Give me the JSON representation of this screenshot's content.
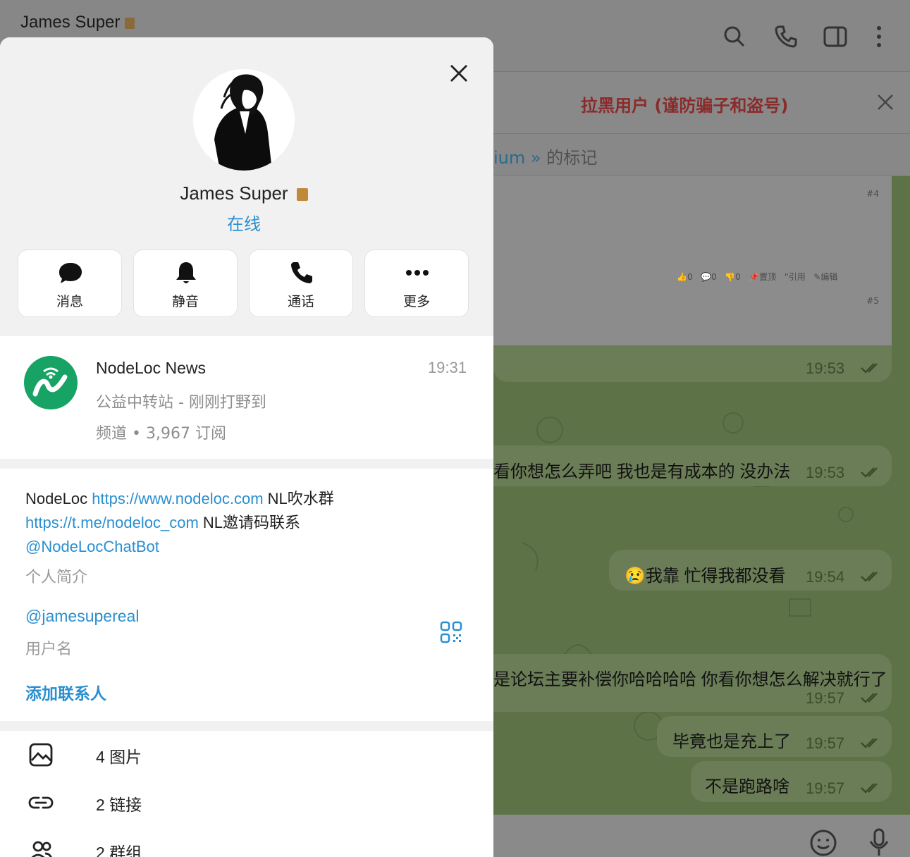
{
  "chat": {
    "title": "James Super",
    "pinned": "拉黑用户 (谨防骗子和盗号)",
    "tag_link": "ium »",
    "tag_suffix": " 的标记",
    "forum_post_numbers": [
      "#4",
      "#5"
    ],
    "forum_actions": "0  0  0  置顶  引用  编辑",
    "forum_action_items": [
      {
        "icon": "thumbs-up-icon",
        "label": "0"
      },
      {
        "icon": "comment-icon",
        "label": "0"
      },
      {
        "icon": "thumbs-down-icon",
        "label": "0"
      },
      {
        "icon": "pin-icon",
        "label": "置顶"
      },
      {
        "icon": "quote-icon",
        "label": "引用"
      },
      {
        "icon": "edit-icon",
        "label": "编辑"
      }
    ],
    "messages": [
      {
        "text": "",
        "time": "19:53"
      },
      {
        "text": "看你想怎么弄吧 我也是有成本的 没办法",
        "time": "19:53"
      },
      {
        "text": "😢我靠 忙得我都没看",
        "time": "19:54"
      },
      {
        "text": "是论坛主要补偿你哈哈哈哈 你看你想怎么解决就行了",
        "time": "19:57"
      },
      {
        "text": "毕竟也是充上了",
        "time": "19:57"
      },
      {
        "text": "不是跑路啥",
        "time": "19:57"
      }
    ],
    "header_icons": [
      "search-icon",
      "phone-icon",
      "sidebar-toggle-icon",
      "more-vertical-icon"
    ],
    "composer_icons": [
      "emoji-icon",
      "microphone-icon"
    ]
  },
  "profile": {
    "name": "James Super",
    "status": "在线",
    "actions": [
      {
        "label": "消息",
        "icon": "message-bubble-icon"
      },
      {
        "label": "静音",
        "icon": "bell-icon"
      },
      {
        "label": "通话",
        "icon": "phone-icon"
      },
      {
        "label": "更多",
        "icon": "more-horizontal-icon"
      }
    ],
    "channel": {
      "name": "NodeLoc News",
      "time": "19:31",
      "subtitle": "公益中转站 - 刚刚打野到",
      "meta": "频道 • 3,967 订阅"
    },
    "bio": {
      "t1": "NodeLoc ",
      "link1": "https://www.nodeloc.com",
      "t2": " NL吹水群",
      "link2": "https://t.me/nodeloc_com",
      "t3": " NL邀请码联系",
      "link3": "@NodeLocChatBot",
      "label": "个人简介"
    },
    "username": "@jamesupereal",
    "username_label": "用户名",
    "add_contact": "添加联系人",
    "media": [
      {
        "label": "4 图片",
        "icon": "image-icon"
      },
      {
        "label": "2 链接",
        "icon": "link-icon"
      },
      {
        "label": "2 群组",
        "icon": "group-icon"
      }
    ]
  },
  "colors": {
    "accent": "#2a8fd0",
    "channel_logo": "#17a364",
    "pinned_text": "#8a2b2b",
    "wallpaper": "#5d7347"
  }
}
